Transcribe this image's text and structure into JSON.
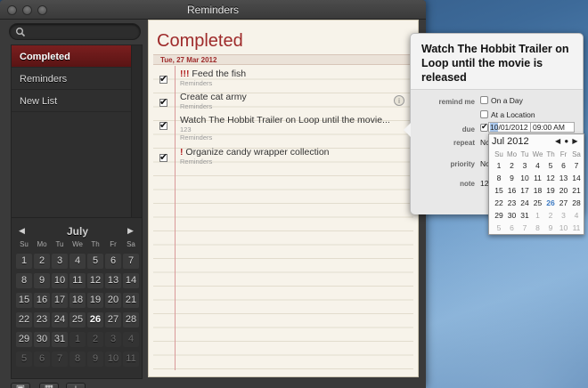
{
  "window": {
    "title": "Reminders"
  },
  "sidebar": {
    "lists": [
      {
        "label": "Completed",
        "selected": true
      },
      {
        "label": "Reminders",
        "selected": false
      },
      {
        "label": "New List",
        "selected": false
      }
    ],
    "calendar": {
      "month": "July",
      "weekdays": [
        "Su",
        "Mo",
        "Tu",
        "We",
        "Th",
        "Fr",
        "Sa"
      ],
      "weeks": [
        [
          "1",
          "2",
          "3",
          "4",
          "5",
          "6",
          "7"
        ],
        [
          "8",
          "9",
          "10",
          "11",
          "12",
          "13",
          "14"
        ],
        [
          "15",
          "16",
          "17",
          "18",
          "19",
          "20",
          "21"
        ],
        [
          "22",
          "23",
          "24",
          "25",
          "26",
          "27",
          "28"
        ],
        [
          "29",
          "30",
          "31",
          "1",
          "2",
          "3",
          "4"
        ],
        [
          "5",
          "6",
          "7",
          "8",
          "9",
          "10",
          "11"
        ]
      ],
      "today": "26",
      "prev_icon": "◀",
      "next_icon": "▶"
    },
    "bottom_buttons": [
      {
        "name": "show-sidebar-button",
        "icon": "▣"
      },
      {
        "name": "calendar-button",
        "icon": "▦"
      },
      {
        "name": "add-list-button",
        "icon": "+"
      }
    ]
  },
  "main": {
    "title": "Completed",
    "date_header": "Tue, 27 Mar 2012",
    "tasks": [
      {
        "priority": "!!!",
        "title": "Feed the fish",
        "list": "Reminders",
        "note": ""
      },
      {
        "priority": "",
        "title": "Create cat army",
        "list": "Reminders",
        "note": ""
      },
      {
        "priority": "",
        "title": "Watch The Hobbit Trailer on Loop until the movie...",
        "list": "Reminders",
        "note": "123"
      },
      {
        "priority": "!",
        "title": "Organize candy wrapper collection",
        "list": "Reminders",
        "note": ""
      }
    ],
    "info_icon": "i"
  },
  "popover": {
    "title": "Watch The Hobbit Trailer on Loop until the movie is released",
    "remind_me_label": "remind me",
    "on_a_day": "On a Day",
    "at_a_location": "At a Location",
    "due_label": "due",
    "due_date_highlight": "10",
    "due_date_rest": "/01/2012",
    "due_time": "09:00 AM",
    "repeat_label": "repeat",
    "repeat_value": "No",
    "priority_label": "priority",
    "priority_value": "No",
    "note_label": "note",
    "note_value": "12"
  },
  "date_picker": {
    "month": "Jul 2012",
    "nav": "◀ ● ▶",
    "weekdays": [
      "Su",
      "Mo",
      "Tu",
      "We",
      "Th",
      "Fr",
      "Sa"
    ],
    "weeks": [
      [
        "1",
        "2",
        "3",
        "4",
        "5",
        "6",
        "7"
      ],
      [
        "8",
        "9",
        "10",
        "11",
        "12",
        "13",
        "14"
      ],
      [
        "15",
        "16",
        "17",
        "18",
        "19",
        "20",
        "21"
      ],
      [
        "22",
        "23",
        "24",
        "25",
        "26",
        "27",
        "28"
      ],
      [
        "29",
        "30",
        "31",
        "1",
        "2",
        "3",
        "4"
      ],
      [
        "5",
        "6",
        "7",
        "8",
        "9",
        "10",
        "11"
      ]
    ],
    "today": "26"
  }
}
